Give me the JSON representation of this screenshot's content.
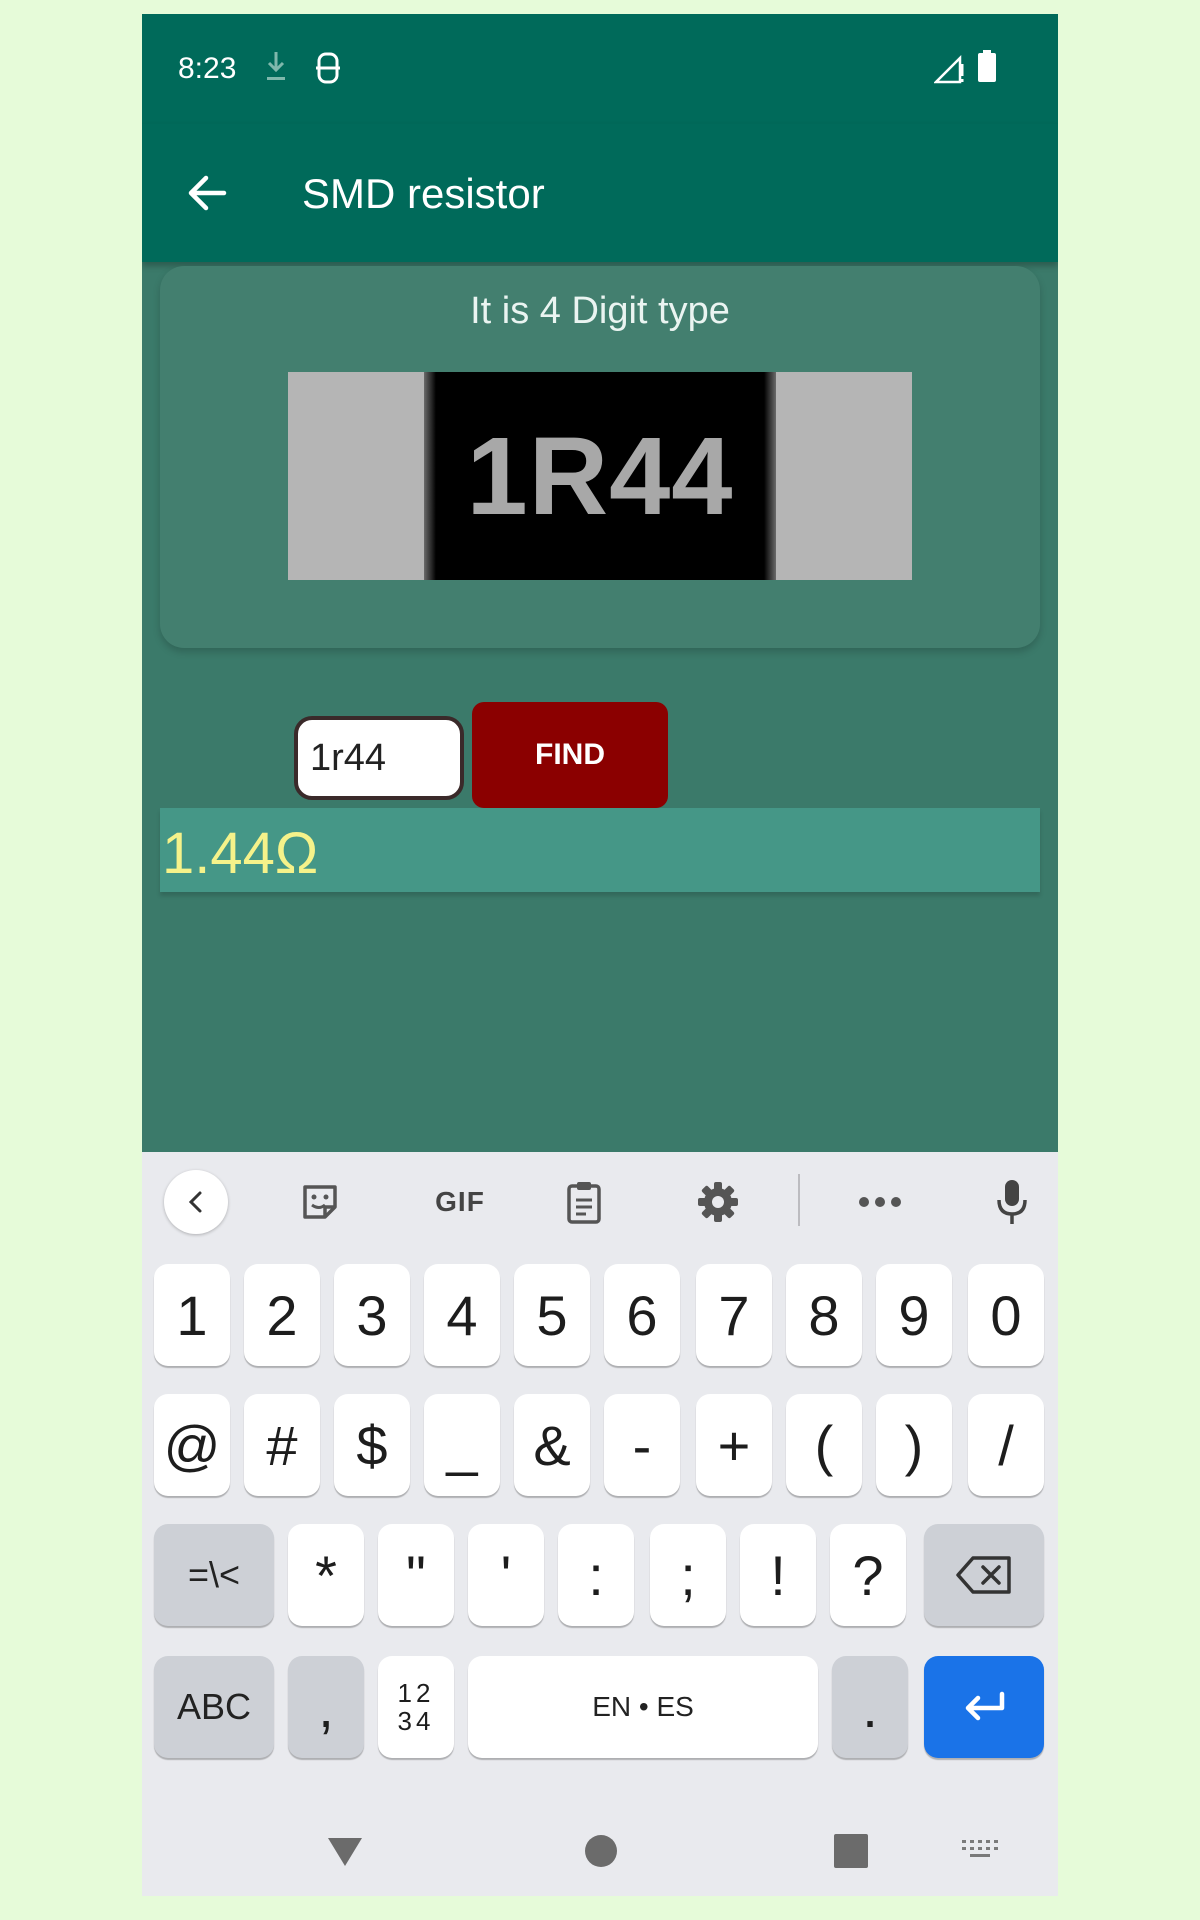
{
  "status_bar": {
    "time": "8:23"
  },
  "app_bar": {
    "title": "SMD resistor"
  },
  "card": {
    "title": "It is 4 Digit type",
    "resistor_code": "1R44"
  },
  "input": {
    "value": "1r44"
  },
  "find_button": {
    "label": "FIND"
  },
  "result": {
    "value": "1.44Ω"
  },
  "keyboard": {
    "toolbar": {
      "gif_label": "GIF"
    },
    "row1": [
      "1",
      "2",
      "3",
      "4",
      "5",
      "6",
      "7",
      "8",
      "9",
      "0"
    ],
    "row2": [
      "@",
      "#",
      "$",
      "_",
      "&",
      "-",
      "+",
      "(",
      ")",
      "/"
    ],
    "row3": {
      "symbols_toggle": "=\\<",
      "keys": [
        "*",
        "\"",
        "'",
        ":",
        ";",
        "!",
        "?"
      ]
    },
    "row4": {
      "abc": "ABC",
      "comma": ",",
      "num_toggle_top": "12",
      "num_toggle_bottom": "34",
      "space": "EN • ES",
      "period": "."
    }
  },
  "colors": {
    "app_bar": "#006a5a",
    "background": "#3b7a6a",
    "find_button": "#8b0000",
    "result_text": "#f5f28a",
    "enter_key": "#1a73e8"
  },
  "icons": {
    "status": [
      "download-icon",
      "sync-icon",
      "signal-icon",
      "battery-icon"
    ],
    "toolbar": [
      "chevron-left-icon",
      "sticker-icon",
      "gif-icon",
      "clipboard-icon",
      "settings-icon",
      "more-icon",
      "microphone-icon"
    ],
    "keys": [
      "backspace-icon",
      "enter-icon"
    ],
    "nav": [
      "back-triangle-icon",
      "home-circle-icon",
      "recents-square-icon",
      "keyboard-switch-icon"
    ]
  }
}
